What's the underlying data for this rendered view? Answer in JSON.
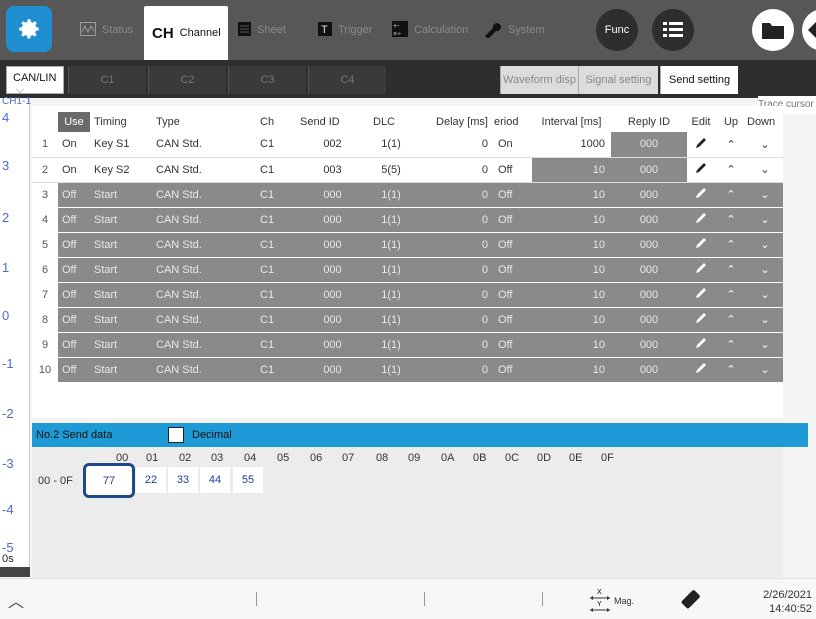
{
  "topbar": {
    "tabs": [
      {
        "label": "Status",
        "icon": "wave-icon"
      },
      {
        "label": "Channel",
        "icon": "CH"
      },
      {
        "label": "Sheet",
        "icon": "sheet-icon"
      },
      {
        "label": "Trigger",
        "icon": "trigger-icon"
      },
      {
        "label": "Calculation",
        "icon": "calculation-icon"
      },
      {
        "label": "System",
        "icon": "wrench-icon"
      }
    ],
    "func_label": "Func",
    "ch_label": "CH"
  },
  "subbar": {
    "selector": "CAN/LIN",
    "channel_tabs": [
      "C1",
      "C2",
      "C3",
      "C4"
    ],
    "right_tabs": [
      "Waveform disp",
      "Signal setting",
      "Send setting"
    ],
    "trace_cursor": "Trace cursor"
  },
  "background": {
    "ch_label": "CH1-1",
    "y_labels": [
      "4",
      "3",
      "2",
      "1",
      "0",
      "-1",
      "-2",
      "-3",
      "-4",
      "-5"
    ],
    "x_label": "0s"
  },
  "table": {
    "headers": [
      "",
      "Use",
      "Timing",
      "Type",
      "Ch",
      "Send ID",
      "DLC",
      "Delay [ms]",
      "eriod",
      "Interval [ms]",
      "Reply ID",
      "Edit",
      "Up",
      "Down"
    ],
    "rows": [
      {
        "no": "1",
        "use": "On",
        "timing": "Key S1",
        "type": "CAN Std.",
        "ch": "C1",
        "send_id": "002",
        "dlc": "1(1)",
        "delay": "0",
        "period": "On",
        "interval": "1000",
        "reply_id": "000"
      },
      {
        "no": "2",
        "use": "On",
        "timing": "Key S2",
        "type": "CAN Std.",
        "ch": "C1",
        "send_id": "003",
        "dlc": "5(5)",
        "delay": "0",
        "period": "Off",
        "interval": "10",
        "reply_id": "000"
      },
      {
        "no": "3",
        "use": "Off",
        "timing": "Start",
        "type": "CAN Std.",
        "ch": "C1",
        "send_id": "000",
        "dlc": "1(1)",
        "delay": "0",
        "period": "Off",
        "interval": "10",
        "reply_id": "000"
      },
      {
        "no": "4",
        "use": "Off",
        "timing": "Start",
        "type": "CAN Std.",
        "ch": "C1",
        "send_id": "000",
        "dlc": "1(1)",
        "delay": "0",
        "period": "Off",
        "interval": "10",
        "reply_id": "000"
      },
      {
        "no": "5",
        "use": "Off",
        "timing": "Start",
        "type": "CAN Std.",
        "ch": "C1",
        "send_id": "000",
        "dlc": "1(1)",
        "delay": "0",
        "period": "Off",
        "interval": "10",
        "reply_id": "000"
      },
      {
        "no": "6",
        "use": "Off",
        "timing": "Start",
        "type": "CAN Std.",
        "ch": "C1",
        "send_id": "000",
        "dlc": "1(1)",
        "delay": "0",
        "period": "Off",
        "interval": "10",
        "reply_id": "000"
      },
      {
        "no": "7",
        "use": "Off",
        "timing": "Start",
        "type": "CAN Std.",
        "ch": "C1",
        "send_id": "000",
        "dlc": "1(1)",
        "delay": "0",
        "period": "Off",
        "interval": "10",
        "reply_id": "000"
      },
      {
        "no": "8",
        "use": "Off",
        "timing": "Start",
        "type": "CAN Std.",
        "ch": "C1",
        "send_id": "000",
        "dlc": "1(1)",
        "delay": "0",
        "period": "Off",
        "interval": "10",
        "reply_id": "000"
      },
      {
        "no": "9",
        "use": "Off",
        "timing": "Start",
        "type": "CAN Std.",
        "ch": "C1",
        "send_id": "000",
        "dlc": "1(1)",
        "delay": "0",
        "period": "Off",
        "interval": "10",
        "reply_id": "000"
      },
      {
        "no": "10",
        "use": "Off",
        "timing": "Start",
        "type": "CAN Std.",
        "ch": "C1",
        "send_id": "000",
        "dlc": "1(1)",
        "delay": "0",
        "period": "Off",
        "interval": "10",
        "reply_id": "000"
      }
    ]
  },
  "send_data": {
    "title": "No.2 Send data",
    "decimal_label": "Decimal",
    "decimal_checked": false,
    "hex_headers": [
      "00",
      "01",
      "02",
      "03",
      "04",
      "05",
      "06",
      "07",
      "08",
      "09",
      "0A",
      "0B",
      "0C",
      "0D",
      "0E",
      "0F"
    ],
    "row_label": "00 - 0F",
    "values": [
      "77",
      "22",
      "33",
      "44",
      "55"
    ]
  },
  "status": {
    "mag_label": "Mag.",
    "date": "2/26/2021",
    "time": "14:40:52"
  },
  "colors": {
    "accent": "#1e9bd7",
    "topbar": "#575757",
    "disabled_cell": "#8a8a8a"
  }
}
